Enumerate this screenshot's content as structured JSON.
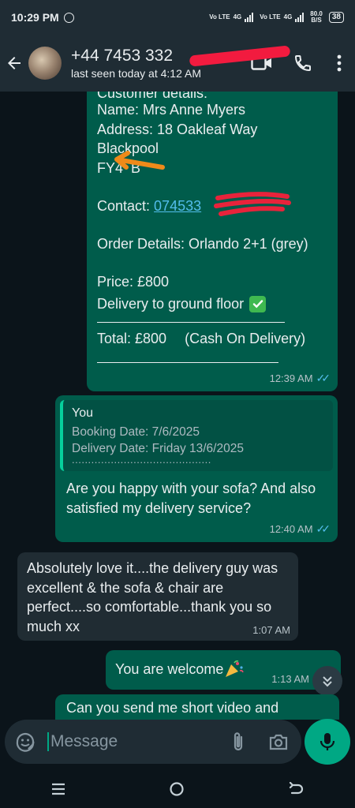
{
  "status": {
    "time": "10:29 PM",
    "sim1": "Vo LTE",
    "sim1_net": "4G",
    "sim2": "Vo LTE",
    "sim2_net": "4G",
    "speed": "80.0",
    "speed_unit": "B/S",
    "battery": "38"
  },
  "header": {
    "contact_name": "+44 7453 332",
    "last_seen": "last seen today at 4:12 AM"
  },
  "messages": {
    "order": {
      "header_partial": "Customer details:",
      "name": "Name: Mrs Anne Myers",
      "address": "Address: 18 Oakleaf Way",
      "city": "Blackpool",
      "postcode": "FY4  B",
      "contact_label": "Contact: ",
      "contact_number": "074533",
      "order_details": "Order Details: Orlando 2+1 (grey)",
      "price": "Price: £800",
      "delivery": "Delivery to ground floor",
      "total": "Total: £800",
      "payment": "(Cash On Delivery)",
      "time": "12:39 AM"
    },
    "reply": {
      "quote_author": "You",
      "quote_line1": "Booking Date: 7/6/2025",
      "quote_line2": "Delivery Date: Friday 13/6/2025",
      "quote_line3": "...........................................",
      "text": "Are you happy with your sofa? And also satisfied my delivery service?",
      "time": "12:40 AM"
    },
    "incoming": {
      "text": "Absolutely love it....the delivery guy was excellent & the sofa & chair are perfect....so comfortable...thank you so much xx",
      "time": "1:07 AM"
    },
    "welcome": {
      "text": "You are welcome",
      "time": "1:13 AM"
    },
    "partial": {
      "text": "Can you send me short video and"
    }
  },
  "composer": {
    "placeholder": "Message"
  }
}
